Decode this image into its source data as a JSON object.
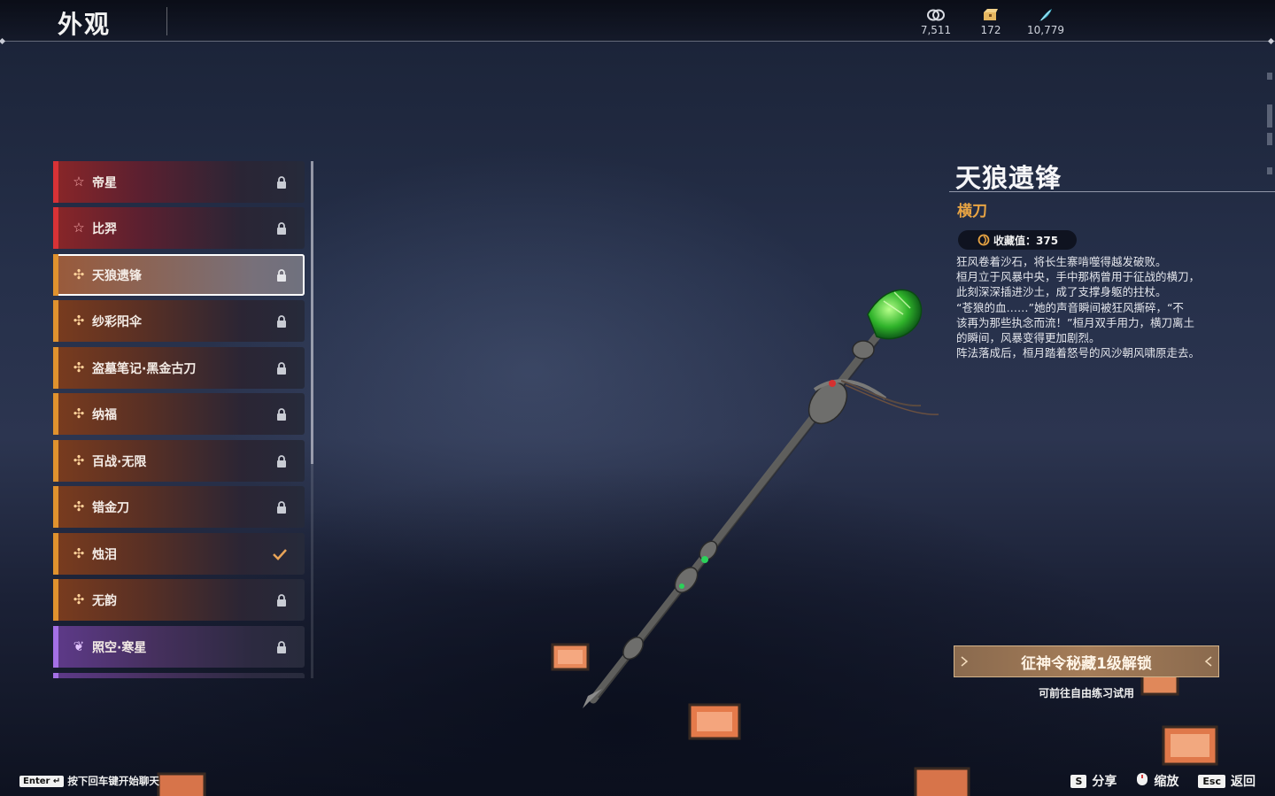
{
  "header": {
    "title": "外观"
  },
  "currencies": [
    {
      "icon": "mask-coin-icon",
      "value": "7,511"
    },
    {
      "icon": "treasure-chest-icon",
      "value": "172"
    },
    {
      "icon": "feather-token-icon",
      "value": "10,779"
    }
  ],
  "list": {
    "items": [
      {
        "label": "帝星",
        "rarity": "red",
        "status": "locked",
        "icon": "star-outline-icon"
      },
      {
        "label": "比羿",
        "rarity": "red",
        "status": "locked",
        "icon": "star-outline-icon"
      },
      {
        "label": "天狼遗锋",
        "rarity": "gold",
        "status": "locked",
        "icon": "petal-cross-icon",
        "selected": true
      },
      {
        "label": "纱彩阳伞",
        "rarity": "gold",
        "status": "locked",
        "icon": "petal-cross-icon"
      },
      {
        "label": "盗墓笔记·黑金古刀",
        "rarity": "gold",
        "status": "locked",
        "icon": "petal-cross-icon"
      },
      {
        "label": "纳福",
        "rarity": "gold",
        "status": "locked",
        "icon": "petal-cross-icon"
      },
      {
        "label": "百战·无限",
        "rarity": "gold",
        "status": "locked",
        "icon": "petal-cross-icon"
      },
      {
        "label": "错金刀",
        "rarity": "gold",
        "status": "locked",
        "icon": "petal-cross-icon"
      },
      {
        "label": "烛泪",
        "rarity": "gold",
        "status": "owned",
        "icon": "petal-cross-icon"
      },
      {
        "label": "无韵",
        "rarity": "gold",
        "status": "locked",
        "icon": "petal-cross-icon"
      },
      {
        "label": "照空·寒星",
        "rarity": "purple",
        "status": "locked",
        "icon": "trefoil-icon"
      }
    ]
  },
  "detail": {
    "name": "天狼遗锋",
    "type": "横刀",
    "collection": "收藏值：375",
    "description": [
      "狂风卷着沙石，将长生寨啃噬得越发破败。",
      "桓月立于风暴中央，手中那柄曾用于征战的横刀，",
      "此刻深深插进沙土，成了支撑身躯的拄杖。",
      "“苍狼的血……”她的声音瞬间被狂风撕碎，“不",
      "该再为那些执念而流！”桓月双手用力，横刀离土",
      "的瞬间，风暴变得更加剧烈。",
      "阵法落成后，桓月踏着怒号的风沙朝风啸原走去。"
    ],
    "unlock_button": "征神令秘藏1级解锁",
    "unlock_hint": "可前往自由练习试用"
  },
  "bottom": {
    "chat_key": "Enter",
    "chat_hint": "按下回车键开始聊天",
    "controls": [
      {
        "key": "S",
        "label": "分享"
      },
      {
        "key": "",
        "label": "缩放",
        "icon": "mouse-icon"
      },
      {
        "key": "Esc",
        "label": "返回"
      }
    ]
  },
  "colors": {
    "accent_gold": "#e8a443",
    "rarity_red": "#d83236",
    "rarity_gold": "#e0922e",
    "rarity_purple": "#a470e6"
  }
}
